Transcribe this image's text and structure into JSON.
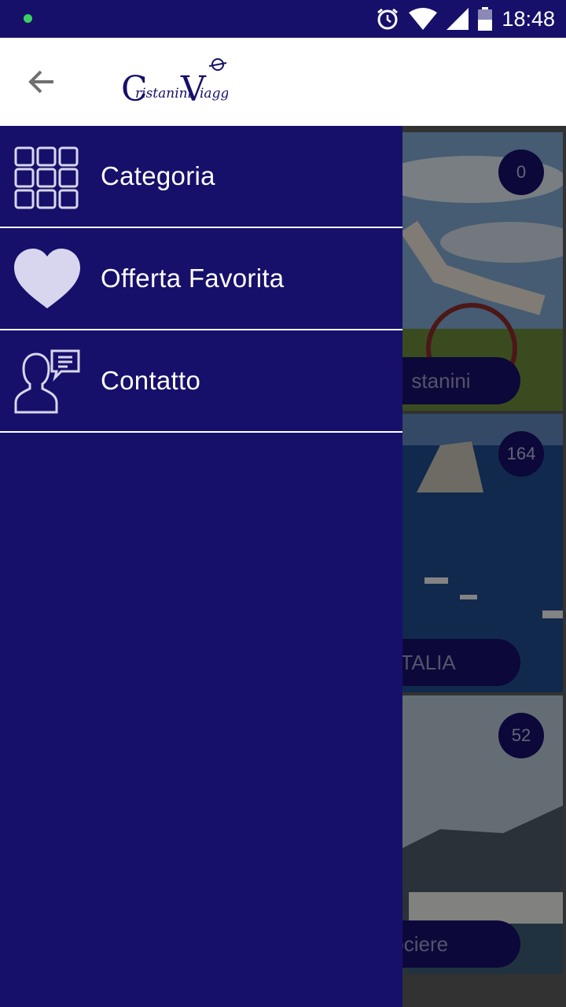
{
  "status_bar": {
    "time": "18:48",
    "icons": [
      "notification-dot-icon",
      "alarm-icon",
      "wifi-icon",
      "signal-icon",
      "battery-icon"
    ]
  },
  "app_bar": {
    "back_icon": "back-arrow-icon",
    "logo_text_1": "ristanini",
    "logo_text_2": "iaggi"
  },
  "drawer": {
    "items": [
      {
        "label": "Categoria",
        "icon": "grid-icon"
      },
      {
        "label": "Offerta Favorita",
        "icon": "heart-icon"
      },
      {
        "label": "Contatto",
        "icon": "contact-icon"
      }
    ]
  },
  "cards": [
    {
      "count": "0",
      "label": "stanini"
    },
    {
      "count": "164",
      "label": "ITALIA"
    },
    {
      "count": "52",
      "label": "Crociere"
    }
  ],
  "colors": {
    "primary": "#16106a",
    "accent_dot": "#3ccf63",
    "drawer_text": "#ffffff"
  }
}
